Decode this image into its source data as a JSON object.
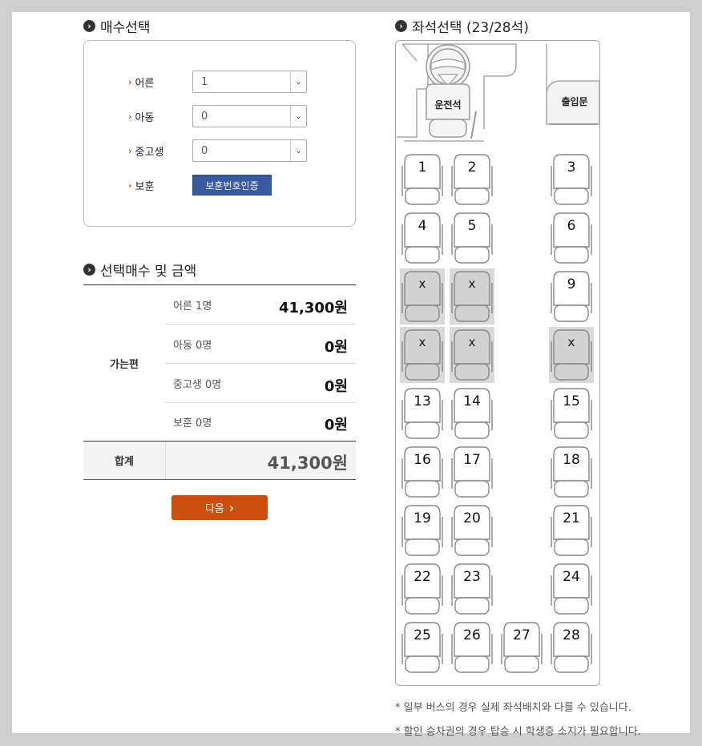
{
  "section_quantity": {
    "title": "매수선택"
  },
  "quantity_rows": [
    {
      "label": "어른",
      "value": "1"
    },
    {
      "label": "아동",
      "value": "0"
    },
    {
      "label": "중고생",
      "value": "0"
    }
  ],
  "veteran": {
    "label": "보훈",
    "button": "보훈번호인증"
  },
  "section_summary": {
    "title": "선택매수 및 금액"
  },
  "summary": {
    "direction": "가는편",
    "rows": [
      {
        "label": "어른 1명",
        "amount": "41,300원"
      },
      {
        "label": "아동 0명",
        "amount": "0원"
      },
      {
        "label": "중고생 0명",
        "amount": "0원"
      },
      {
        "label": "보훈 0명",
        "amount": "0원"
      }
    ],
    "total_label": "합계",
    "total_amount": "41,300원"
  },
  "next_button": {
    "label": "다음"
  },
  "section_seat": {
    "title": "좌석선택 (23/28석)"
  },
  "bus": {
    "driver_label": "운전석",
    "door_label": "출입문"
  },
  "seats": [
    {
      "label": "1",
      "taken": false
    },
    {
      "label": "2",
      "taken": false
    },
    {
      "label": "3",
      "taken": false
    },
    {
      "label": "4",
      "taken": false
    },
    {
      "label": "5",
      "taken": false
    },
    {
      "label": "6",
      "taken": false
    },
    {
      "label": "x",
      "taken": true
    },
    {
      "label": "x",
      "taken": true
    },
    {
      "label": "9",
      "taken": false
    },
    {
      "label": "x",
      "taken": true
    },
    {
      "label": "x",
      "taken": true
    },
    {
      "label": "x",
      "taken": true
    },
    {
      "label": "13",
      "taken": false
    },
    {
      "label": "14",
      "taken": false
    },
    {
      "label": "15",
      "taken": false
    },
    {
      "label": "16",
      "taken": false
    },
    {
      "label": "17",
      "taken": false
    },
    {
      "label": "18",
      "taken": false
    },
    {
      "label": "19",
      "taken": false
    },
    {
      "label": "20",
      "taken": false
    },
    {
      "label": "21",
      "taken": false
    },
    {
      "label": "22",
      "taken": false
    },
    {
      "label": "23",
      "taken": false
    },
    {
      "label": "24",
      "taken": false
    },
    {
      "label": "25",
      "taken": false
    },
    {
      "label": "26",
      "taken": false
    },
    {
      "label": "27",
      "taken": false
    },
    {
      "label": "28",
      "taken": false
    }
  ],
  "notes": [
    "* 일부 버스의 경우 실제 좌석배치와 다를 수 있습니다.",
    "* 할인 승차권의 경우 탑승 시 학생증 소지가 필요합니다."
  ],
  "colors": {
    "accent": "#cc4e0a",
    "veteran_button": "#3a5aa0",
    "taken_seat": "#d9d9d9"
  }
}
